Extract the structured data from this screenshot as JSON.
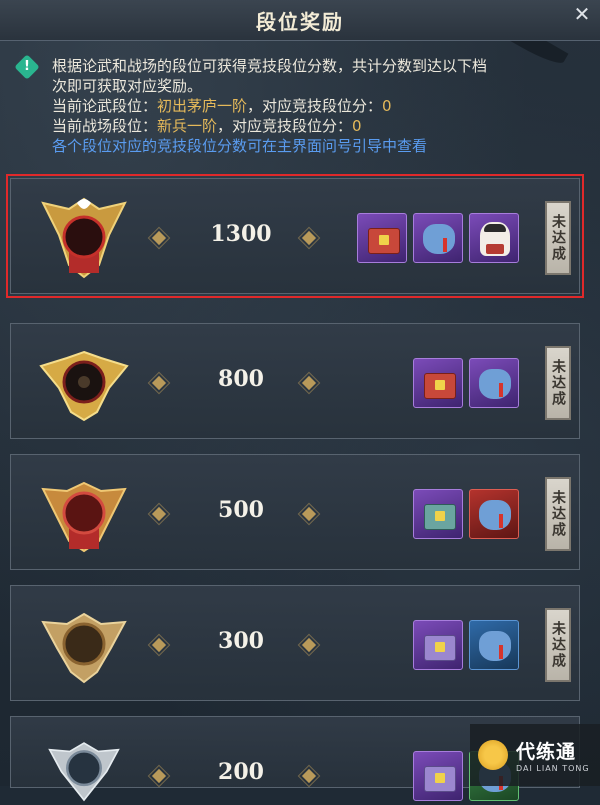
{
  "header": {
    "title": "段位奖励",
    "close_icon": "close-icon"
  },
  "info": {
    "icon": "info-icon",
    "line1": "根据论武和战场的段位可获得竞技段位分数，共计分数到达以下档",
    "line2": "次即可获取对应奖励。",
    "lunwu_prefix": "当前论武段位：",
    "lunwu_rank": "初出茅庐一阶",
    "lunwu_mid": "，对应竞技段位分：",
    "lunwu_score": "0",
    "battle_prefix": "当前战场段位：",
    "battle_rank": "新兵一阶",
    "battle_mid": "，对应竞技段位分：",
    "battle_score": "0",
    "hint": "各个段位对应的竞技段位分数可在主界面问号引导中查看"
  },
  "tiers": [
    {
      "score": "1300",
      "status": "未达成",
      "emblem": "gold-winged-emblem-icon",
      "rewards": [
        "chest-icon",
        "pouch-icon",
        "avatar-frame-icon"
      ]
    },
    {
      "score": "800",
      "status": "未达成",
      "emblem": "gold-winged-emblem-icon",
      "rewards": [
        "chest-icon",
        "pouch-icon"
      ]
    },
    {
      "score": "500",
      "status": "未达成",
      "emblem": "red-winged-emblem-icon",
      "rewards": [
        "chest-icon",
        "pouch-icon"
      ]
    },
    {
      "score": "300",
      "status": "未达成",
      "emblem": "bronze-winged-emblem-icon",
      "rewards": [
        "chest-icon",
        "pouch-icon"
      ]
    },
    {
      "score": "200",
      "status": "",
      "emblem": "silver-winged-emblem-icon",
      "rewards": [
        "chest-icon",
        "pouch-icon"
      ]
    }
  ],
  "watermark": {
    "name": "代练通",
    "sub": "DAI LIAN TONG"
  },
  "colors": {
    "highlight": "#e0292a",
    "gold_text": "#e5b95a",
    "link_blue": "#5a9cf0"
  }
}
